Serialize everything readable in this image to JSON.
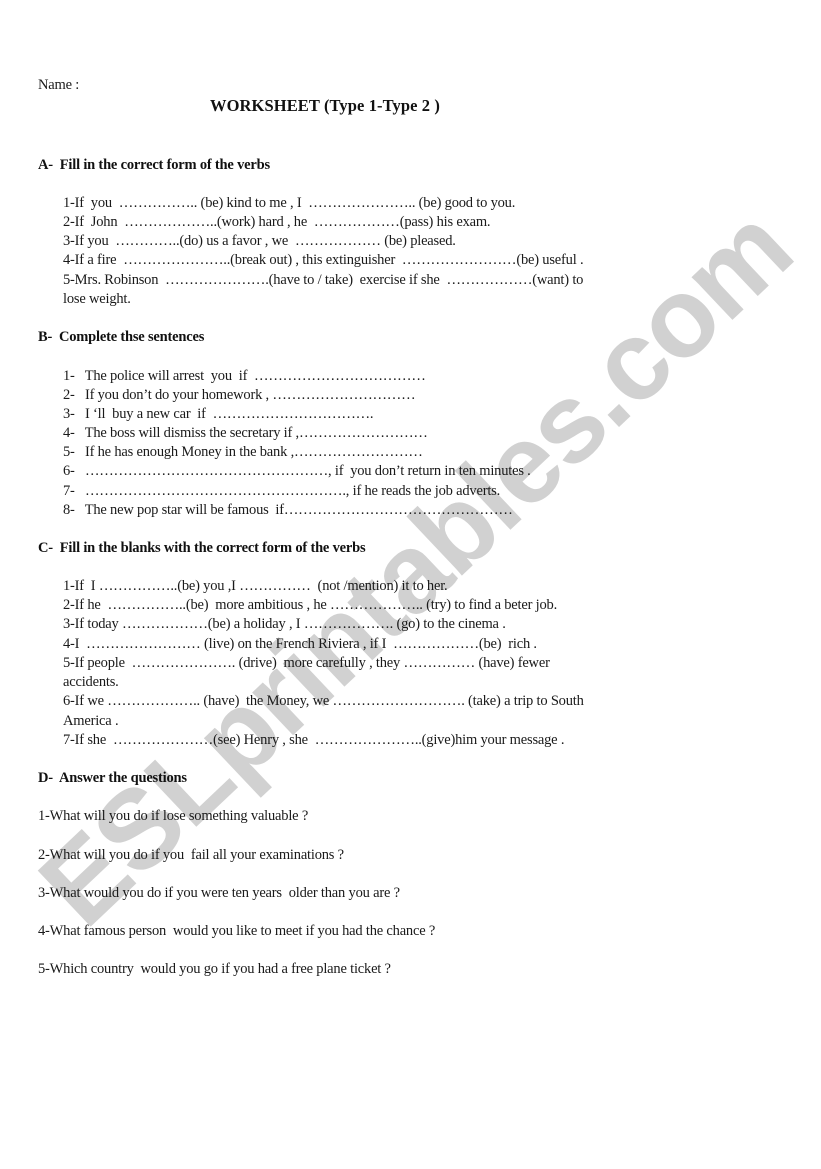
{
  "header": {
    "name_label": "Name :",
    "title": "WORKSHEET (Type 1-Type 2 )"
  },
  "watermark": "ESLprintables.com",
  "section_a": {
    "heading": "A-  Fill in the correct form of the verbs",
    "lines": [
      "1-If  you  …………….. (be) kind to me , I  ………………….. (be) good to you.",
      "2-If  John  ………………..(work) hard , he  ………………(pass) his exam.",
      "3-If you  …………..(do) us a favor , we  ……………… (be) pleased.",
      "4-If a fire  …………………..(break out) , this extinguisher  ……………………(be) useful .",
      "5-Mrs. Robinson  ………………….(have to / take)  exercise if she  ………………(want) to",
      "lose weight."
    ]
  },
  "section_b": {
    "heading": "B-  Complete thse sentences",
    "lines": [
      "1-   The police will arrest  you  if  ………………………………",
      "2-   If you don’t do your homework , …………………………",
      "3-   I ‘ll  buy a new car  if  …………………………….",
      "4-   The boss will dismiss the secretary if ,………………………",
      "5-   If he has enough Money in the bank ,………………………",
      "6-   ……………………………………………, if  you don’t return in ten minutes .",
      "7-   ………………………………………………., if he reads the job adverts.",
      "8-   The new pop star will be famous  if…………………………………………"
    ]
  },
  "section_c": {
    "heading": "C-  Fill in the blanks with the correct form of the verbs",
    "lines": [
      "1-If  I ……………..(be) you ,I ……………  (not /mention) it to her.",
      "2-If he  ……………..(be)  more ambitious , he ……………….. (try) to find a beter job.",
      "3-If today ………………(be) a holiday , I ………………. (go) to the cinema .",
      "4-I  …………………… (live) on the French Riviera , if I  ………………(be)  rich .",
      "5-If people  …………………. (drive)  more carefully , they …………… (have) fewer",
      "accidents.",
      "6-If we ……………….. (have)  the Money, we ………………………. (take) a trip to South",
      "America .",
      "7-If she  …………………(see) Henry , she  …………………..(give)him your message ."
    ]
  },
  "section_d": {
    "heading": "D-  Answer the questions",
    "questions": [
      "1-What will you do if lose something valuable ?",
      "2-What will you do if you  fail all your examinations ?",
      "3-What would you do if you were ten years  older than you are ?",
      "4-What famous person  would you like to meet if you had the chance ?",
      "5-Which country  would you go if you had a free plane ticket ?"
    ]
  }
}
